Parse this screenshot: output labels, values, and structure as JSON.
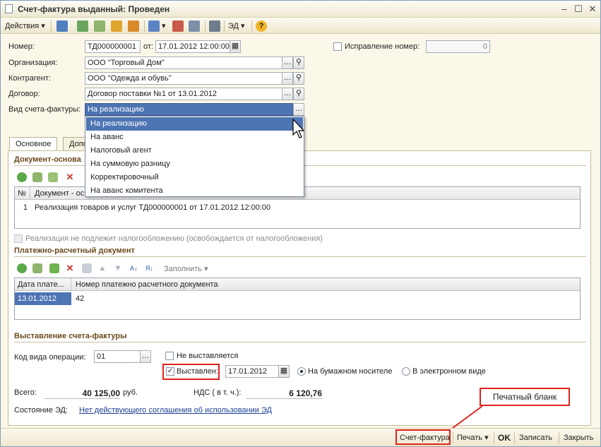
{
  "window": {
    "title": "Счет-фактура выданный: Проведен"
  },
  "toolbar": {
    "actions_label": "Действия",
    "ed_label": "ЭД"
  },
  "form": {
    "number_label": "Номер:",
    "number_value": "ТД000000001",
    "from_label": "от:",
    "date_value": "17.01.2012 12:00:00",
    "correction_label": "Исправление номер:",
    "correction_value": "0",
    "org_label": "Организация:",
    "org_value": "ООО \"Торговый Дом\"",
    "counterparty_label": "Контрагент:",
    "counterparty_value": "ООО \"Одежда и обувь\"",
    "contract_label": "Договор:",
    "contract_value": "Договор поставки №1 от 13.01.2012",
    "invoice_type_label": "Вид счета-фактуры:",
    "invoice_type_value": "На реализацию"
  },
  "dropdown": {
    "options": [
      "На реализацию",
      "На аванс",
      "Налоговый агент",
      "На суммовую разницу",
      "Корректировочный",
      "На аванс комитента"
    ]
  },
  "tabs": {
    "main": "Основное",
    "extra": "Допо"
  },
  "basis_section": {
    "title": "Документ-основа",
    "col_num": "№",
    "col_doc": "Документ - ос",
    "row_num": "1",
    "row_doc": "Реализация товаров и услуг ТД000000001 от 17.01.2012 12:00:00",
    "nontax_label": "Реализация не подлежит налогообложению (освобождается от налогообложения)"
  },
  "payment_section": {
    "title": "Платежно-расчетный документ",
    "fill_label": "Заполнить",
    "col_date": "Дата плате...",
    "col_number": "Номер платежно расчетного документа",
    "row_date": "13.01.2012",
    "row_number": "42"
  },
  "issue_section": {
    "title": "Выставление счета-фактуры",
    "op_code_label": "Код вида операции:",
    "op_code_value": "01",
    "not_issued_label": "Не выставляется",
    "issued_label": "Выставлен:",
    "issued_date": "17.01.2012",
    "paper_label": "На бумажном носителе",
    "electronic_label": "В электронном виде"
  },
  "totals": {
    "total_label": "Всего:",
    "total_value": "40 125,00",
    "currency": "руб.",
    "vat_label": "НДС ( в т. ч.):",
    "vat_value": "6 120,76",
    "ed_state_label": "Состояние ЭД:",
    "ed_state_link": "Нет действующего соглашения об использовании ЭД"
  },
  "bottom": {
    "invoice_btn": "Счет-фактура",
    "print_btn": "Печать",
    "ok_btn": "OK",
    "save_btn": "Записать",
    "close_btn": "Закрыть"
  },
  "callout": {
    "text": "Печатный бланк"
  },
  "colors": {
    "accent_red": "#e0231b",
    "selection": "#4d74b3",
    "section_title": "#6b4a1d"
  }
}
